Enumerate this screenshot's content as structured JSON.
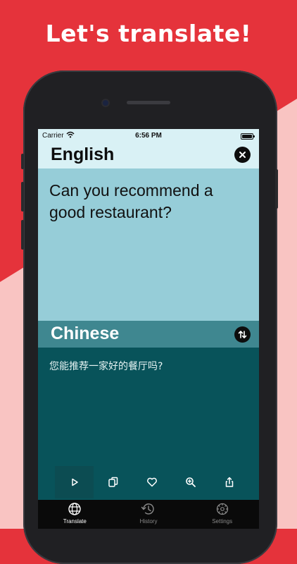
{
  "promo": {
    "headline": "Let's translate!"
  },
  "status_bar": {
    "carrier": "Carrier",
    "time": "6:56 PM"
  },
  "source": {
    "language": "English",
    "text": "Can you recommend a good restaurant?",
    "close_icon": "close-icon"
  },
  "target": {
    "language": "Chinese",
    "text": "您能推荐一家好的餐厅吗?",
    "swap_icon": "swap-icon"
  },
  "actions": [
    {
      "icon": "play-icon"
    },
    {
      "icon": "copy-icon"
    },
    {
      "icon": "heart-icon"
    },
    {
      "icon": "zoom-icon"
    },
    {
      "icon": "share-icon"
    }
  ],
  "tabs": [
    {
      "label": "Translate",
      "icon": "globe-icon",
      "active": true
    },
    {
      "label": "History",
      "icon": "history-icon",
      "active": false
    },
    {
      "label": "Settings",
      "icon": "gear-icon",
      "active": false
    }
  ],
  "colors": {
    "promo_red": "#e5333b",
    "promo_pink": "#f9c4c2",
    "source_body": "#96cdd8",
    "target_header": "#3f8790",
    "target_body": "#08535a"
  }
}
